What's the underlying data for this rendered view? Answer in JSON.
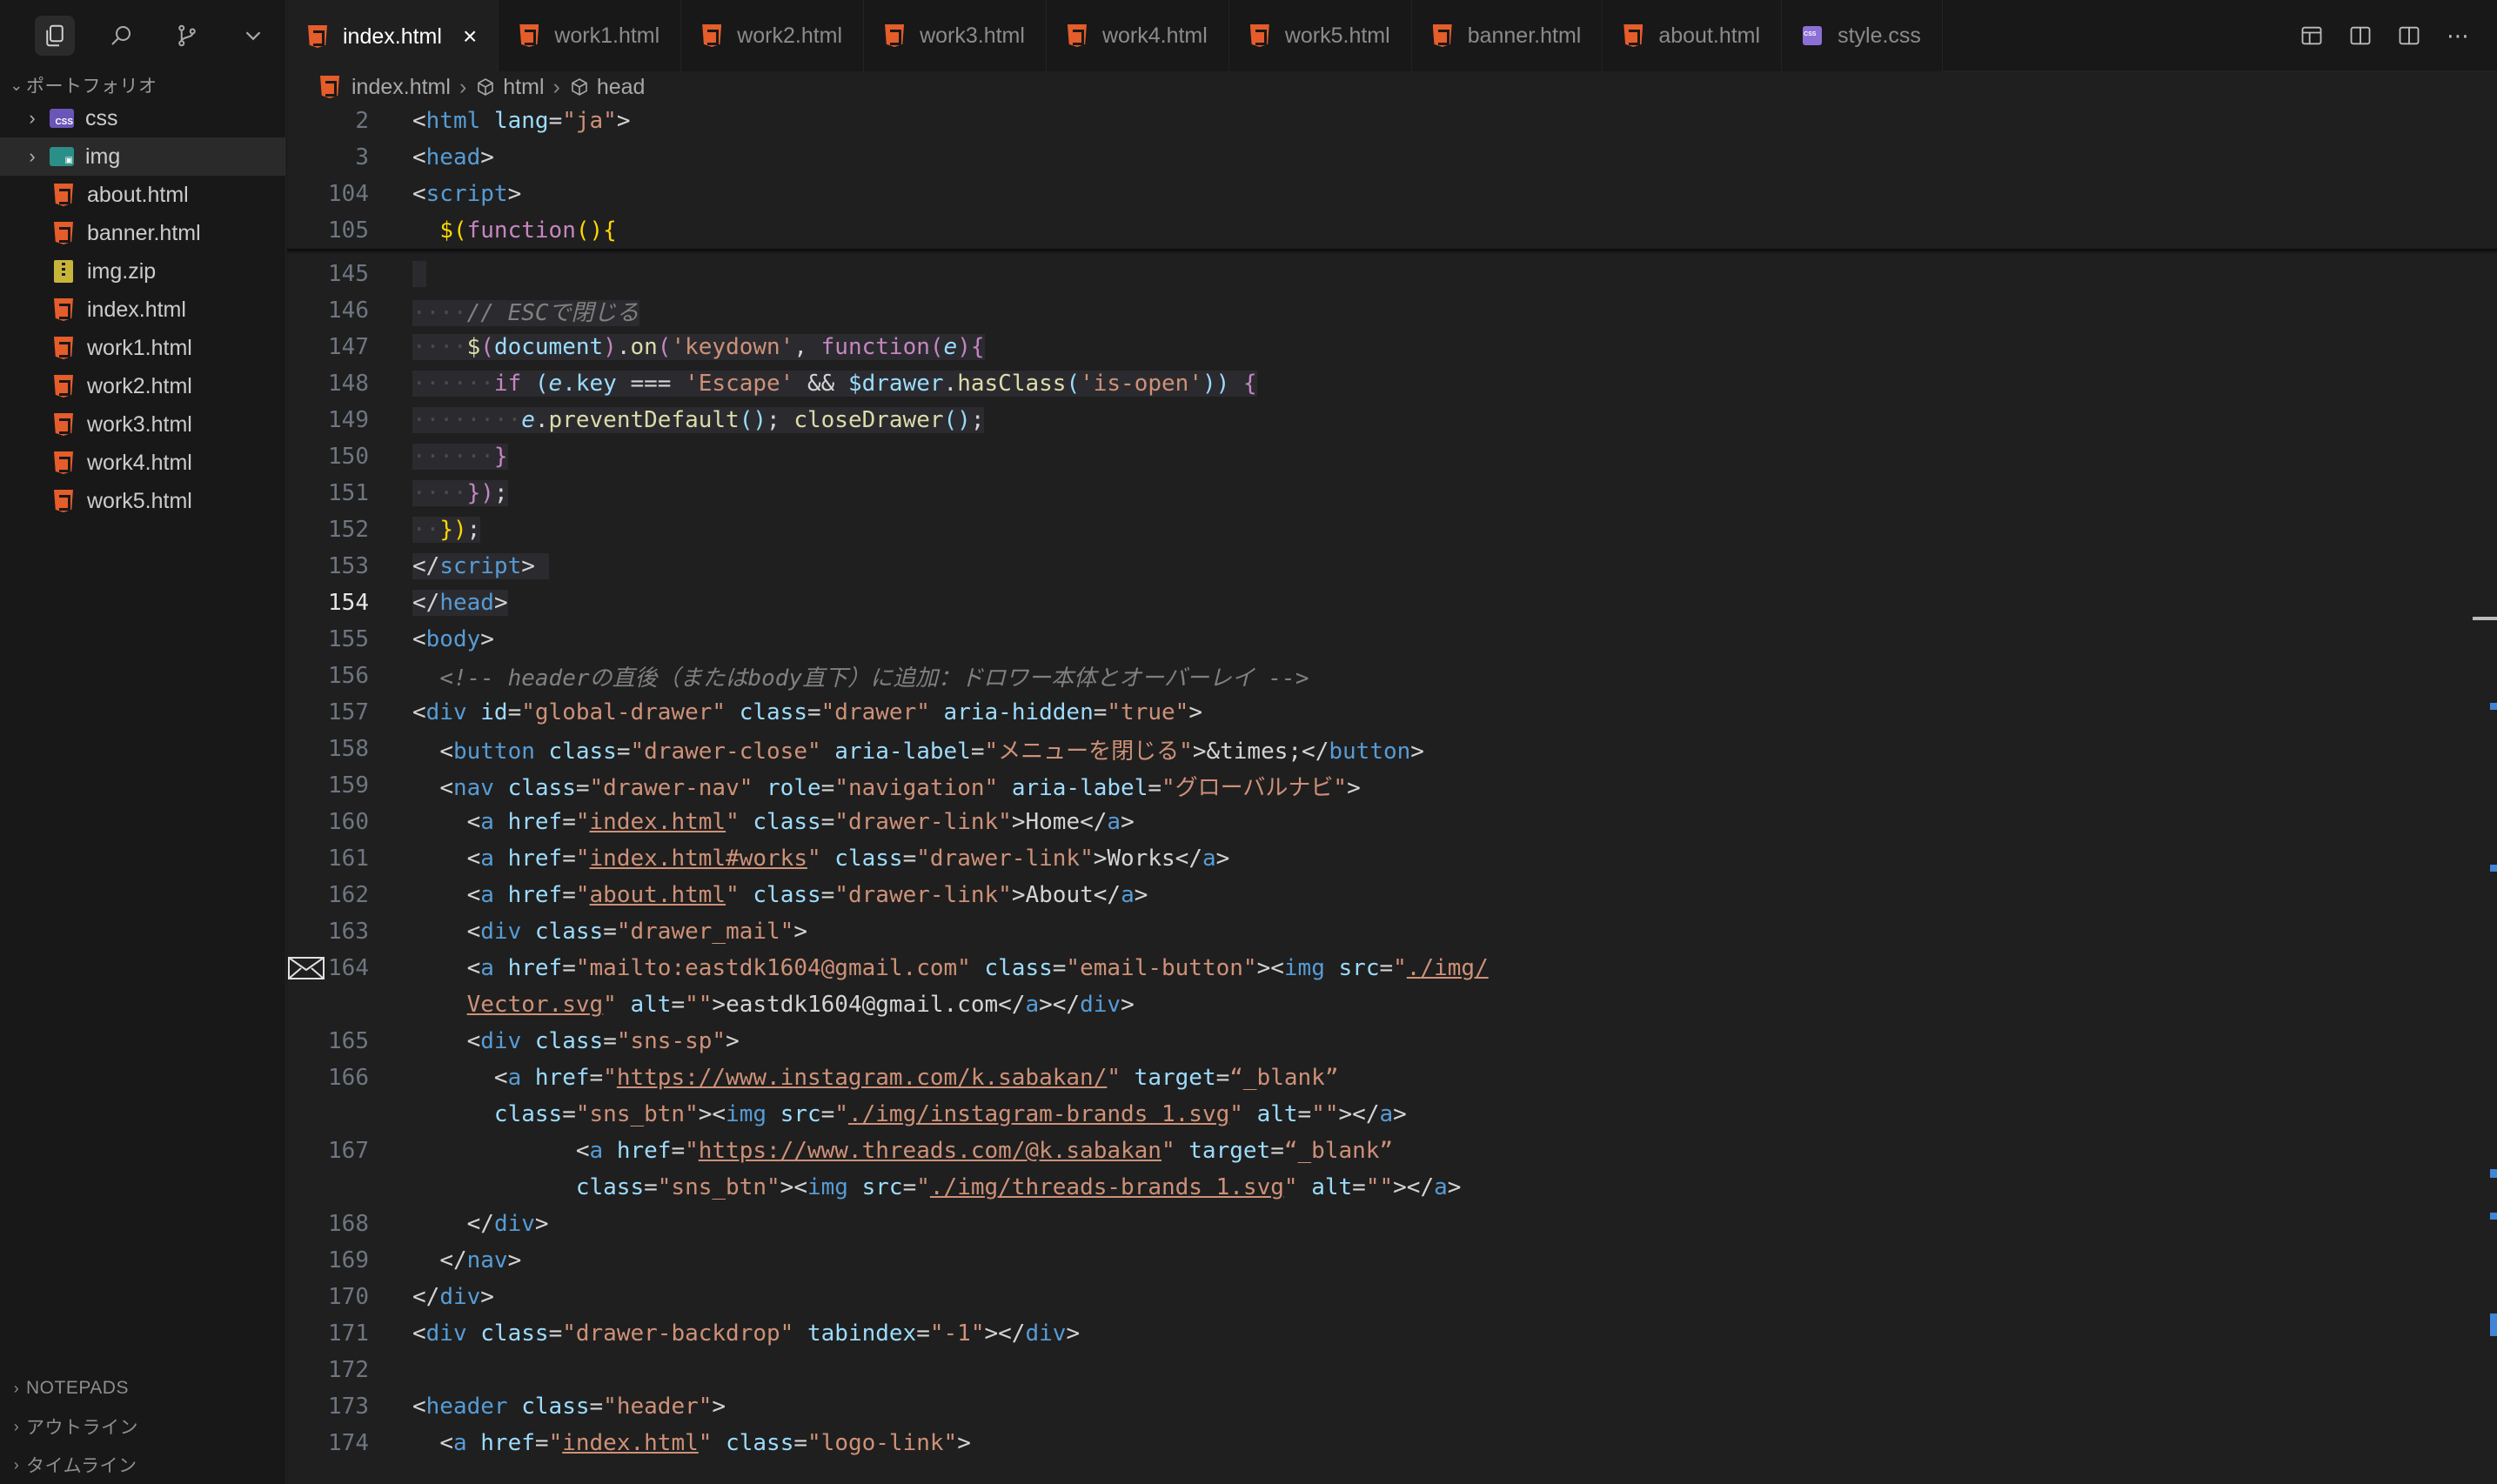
{
  "sidebar": {
    "activity": [
      "explorer-icon",
      "search-icon",
      "source-control-icon",
      "chevron-down-icon"
    ],
    "project_title": "ポートフォリオ",
    "items": [
      {
        "label": "css",
        "type": "folder",
        "icon": "css"
      },
      {
        "label": "img",
        "type": "folder",
        "icon": "img",
        "selected": true
      },
      {
        "label": "about.html",
        "type": "file"
      },
      {
        "label": "banner.html",
        "type": "file"
      },
      {
        "label": "img.zip",
        "type": "zip"
      },
      {
        "label": "index.html",
        "type": "file"
      },
      {
        "label": "work1.html",
        "type": "file"
      },
      {
        "label": "work2.html",
        "type": "file"
      },
      {
        "label": "work3.html",
        "type": "file"
      },
      {
        "label": "work4.html",
        "type": "file"
      },
      {
        "label": "work5.html",
        "type": "file"
      }
    ],
    "panels": [
      "NOTEPADS",
      "アウトライン",
      "タイムライン"
    ]
  },
  "tabs": [
    {
      "label": "index.html",
      "active": true
    },
    {
      "label": "work1.html"
    },
    {
      "label": "work2.html"
    },
    {
      "label": "work3.html"
    },
    {
      "label": "work4.html"
    },
    {
      "label": "work5.html"
    },
    {
      "label": "banner.html"
    },
    {
      "label": "about.html"
    },
    {
      "label": "style.css",
      "css": true
    }
  ],
  "breadcrumb": {
    "file": "index.html",
    "html": "html",
    "head": "head"
  },
  "editor": {
    "current_line": "154",
    "lines": [
      {
        "n": "2",
        "html": "<span class='pun'>&lt;</span><span class='t'>html</span> <span class='a'>lang</span><span class='pun'>=</span><span class='s'>\"ja\"</span><span class='pun'>&gt;</span>"
      },
      {
        "n": "3",
        "html": "<span class='pun'>&lt;</span><span class='t'>head</span><span class='pun'>&gt;</span>"
      },
      {
        "n": "104",
        "html": "<span class='pun'>&lt;</span><span class='t'>script</span><span class='pun'>&gt;</span>"
      },
      {
        "n": "105",
        "html": "  <span class='y'>$(</span><span class='k'>function</span><span class='y'>(){</span>"
      },
      {
        "n": "145",
        "html": "<span class='sel'> </span>"
      },
      {
        "n": "146",
        "html": "<span class='sel'><span class='ws'>····</span><span class='cmt'>// ESCで閉じる</span></span>"
      },
      {
        "n": "147",
        "html": "<span class='sel'><span class='ws'>····</span><span class='f'>$</span><span class='k'>(</span><span class='a'>document</span><span class='k'>)</span>.<span class='f'>on</span><span class='k'>(</span><span class='s'>'keydown'</span>, <span class='k'>function</span><span class='k'>(</span><span class='a'><i>e</i></span><span class='k'>){</span></span>"
      },
      {
        "n": "148",
        "html": "<span class='sel'><span class='ws'>······</span><span class='k'>if</span> <span class='a'>(</span><span class='a'><i>e</i>.key</span> === <span class='s'>'Escape'</span> &amp;&amp; <span class='a'>$drawer</span>.<span class='f'>hasClass</span><span class='a'>(</span><span class='s'>'is-open'</span><span class='a'>)</span><span class='a'>)</span> <span class='k'>{</span></span>"
      },
      {
        "n": "149",
        "html": "<span class='sel'><span class='ws'>········</span><span class='a'><i>e</i></span>.<span class='f'>preventDefault</span><span class='a'>()</span>; <span class='f'>closeDrawer</span><span class='a'>()</span>;</span>"
      },
      {
        "n": "150",
        "html": "<span class='sel'><span class='ws'>······</span><span class='k'>}</span></span>"
      },
      {
        "n": "151",
        "html": "<span class='sel'><span class='ws'>····</span><span class='k'>})</span>;</span>"
      },
      {
        "n": "152",
        "html": "<span class='sel'><span class='ws'>··</span><span class='y'>})</span>;</span>"
      },
      {
        "n": "153",
        "html": "<span class='sel'><span class='pun'>&lt;/</span><span class='t'>script</span><span class='pun'>&gt;</span> </span>"
      },
      {
        "n": "154",
        "html": "<span class='sel'><span class='pun'>&lt;/</span><span class='t'>head</span><span class='pun'>&gt;</span></span>"
      },
      {
        "n": "155",
        "html": "<span class='pun'>&lt;</span><span class='t'>body</span><span class='pun'>&gt;</span>"
      },
      {
        "n": "156",
        "html": "  <span class='cmt'>&lt;!-- headerの直後（またはbody直下）に追加：ドロワー本体とオーバーレイ --&gt;</span>"
      },
      {
        "n": "157",
        "html": "<span class='pun'>&lt;</span><span class='t'>div</span> <span class='a'>id</span><span class='pun'>=</span><span class='s'>\"global-drawer\"</span> <span class='a'>class</span><span class='pun'>=</span><span class='s'>\"drawer\"</span> <span class='a'>aria-hidden</span><span class='pun'>=</span><span class='s'>\"true\"</span><span class='pun'>&gt;</span>"
      },
      {
        "n": "158",
        "html": "  <span class='pun'>&lt;</span><span class='t'>button</span> <span class='a'>class</span><span class='pun'>=</span><span class='s'>\"drawer-close\"</span> <span class='a'>aria-label</span><span class='pun'>=</span><span class='s'>\"メニューを閉じる\"</span><span class='pun'>&gt;</span>&amp;times;<span class='pun'>&lt;/</span><span class='t'>button</span><span class='pun'>&gt;</span>"
      },
      {
        "n": "159",
        "html": "  <span class='pun'>&lt;</span><span class='t'>nav</span> <span class='a'>class</span><span class='pun'>=</span><span class='s'>\"drawer-nav\"</span> <span class='a'>role</span><span class='pun'>=</span><span class='s'>\"navigation\"</span> <span class='a'>aria-label</span><span class='pun'>=</span><span class='s'>\"グローバルナビ\"</span><span class='pun'>&gt;</span>"
      },
      {
        "n": "160",
        "html": "    <span class='pun'>&lt;</span><span class='t'>a</span> <span class='a'>href</span><span class='pun'>=</span><span class='s'>\"<span class='u'>index.html</span>\"</span> <span class='a'>class</span><span class='pun'>=</span><span class='s'>\"drawer-link\"</span><span class='pun'>&gt;</span>Home<span class='pun'>&lt;/</span><span class='t'>a</span><span class='pun'>&gt;</span>"
      },
      {
        "n": "161",
        "html": "    <span class='pun'>&lt;</span><span class='t'>a</span> <span class='a'>href</span><span class='pun'>=</span><span class='s'>\"<span class='u'>index.html#works</span>\"</span> <span class='a'>class</span><span class='pun'>=</span><span class='s'>\"drawer-link\"</span><span class='pun'>&gt;</span>Works<span class='pun'>&lt;/</span><span class='t'>a</span><span class='pun'>&gt;</span>"
      },
      {
        "n": "162",
        "html": "    <span class='pun'>&lt;</span><span class='t'>a</span> <span class='a'>href</span><span class='pun'>=</span><span class='s'>\"<span class='u'>about.html</span>\"</span> <span class='a'>class</span><span class='pun'>=</span><span class='s'>\"drawer-link\"</span><span class='pun'>&gt;</span>About<span class='pun'>&lt;/</span><span class='t'>a</span><span class='pun'>&gt;</span>"
      },
      {
        "n": "163",
        "html": "    <span class='pun'>&lt;</span><span class='t'>div</span> <span class='a'>class</span><span class='pun'>=</span><span class='s'>\"drawer_mail\"</span><span class='pun'>&gt;</span>"
      },
      {
        "n": "164",
        "mail": true,
        "html": "    <span class='pun'>&lt;</span><span class='t'>a</span> <span class='a'>href</span><span class='pun'>=</span><span class='s'>\"mailto:eastdk1604@gmail.com\"</span> <span class='a'>class</span><span class='pun'>=</span><span class='s'>\"email-button\"</span><span class='pun'>&gt;&lt;</span><span class='t'>img</span> <span class='a'>src</span><span class='pun'>=</span><span class='s'>\"<span class='u'>./img/</span></span>"
      },
      {
        "n": "",
        "html": "    <span class='s'><span class='u'>Vector.svg</span>\"</span> <span class='a'>alt</span><span class='pun'>=</span><span class='s'>\"\"</span><span class='pun'>&gt;</span>eastdk1604@gmail.com<span class='pun'>&lt;/</span><span class='t'>a</span><span class='pun'>&gt;&lt;/</span><span class='t'>div</span><span class='pun'>&gt;</span>"
      },
      {
        "n": "165",
        "html": "    <span class='pun'>&lt;</span><span class='t'>div</span> <span class='a'>class</span><span class='pun'>=</span><span class='s'>\"sns-sp\"</span><span class='pun'>&gt;</span>"
      },
      {
        "n": "166",
        "html": "      <span class='pun'>&lt;</span><span class='t'>a</span> <span class='a'>href</span><span class='pun'>=</span><span class='s'>\"<span class='u'>https://www.instagram.com/k.sabakan/</span>\"</span> <span class='a'>target</span><span class='pun'>=</span><span class='s'>“_blank”</span>"
      },
      {
        "n": "",
        "html": "      <span class='a'>class</span><span class='pun'>=</span><span class='s'>\"sns_btn\"</span><span class='pun'>&gt;&lt;</span><span class='t'>img</span> <span class='a'>src</span><span class='pun'>=</span><span class='s'>\"<span class='u'>./img/instagram-brands 1.svg</span>\"</span> <span class='a'>alt</span><span class='pun'>=</span><span class='s'>\"\"</span><span class='pun'>&gt;&lt;/</span><span class='t'>a</span><span class='pun'>&gt;</span>"
      },
      {
        "n": "167",
        "html": "            <span class='pun'>&lt;</span><span class='t'>a</span> <span class='a'>href</span><span class='pun'>=</span><span class='s'>\"<span class='u'>https://www.threads.com/@k.sabakan</span>\"</span> <span class='a'>target</span><span class='pun'>=</span><span class='s'>“_blank”</span>"
      },
      {
        "n": "",
        "html": "            <span class='a'>class</span><span class='pun'>=</span><span class='s'>\"sns_btn\"</span><span class='pun'>&gt;&lt;</span><span class='t'>img</span> <span class='a'>src</span><span class='pun'>=</span><span class='s'>\"<span class='u'>./img/threads-brands 1.svg</span>\"</span> <span class='a'>alt</span><span class='pun'>=</span><span class='s'>\"\"</span><span class='pun'>&gt;&lt;/</span><span class='t'>a</span><span class='pun'>&gt;</span>"
      },
      {
        "n": "168",
        "html": "    <span class='pun'>&lt;/</span><span class='t'>div</span><span class='pun'>&gt;</span>"
      },
      {
        "n": "169",
        "html": "  <span class='pun'>&lt;/</span><span class='t'>nav</span><span class='pun'>&gt;</span>"
      },
      {
        "n": "170",
        "html": "<span class='pun'>&lt;/</span><span class='t'>div</span><span class='pun'>&gt;</span>"
      },
      {
        "n": "171",
        "html": "<span class='pun'>&lt;</span><span class='t'>div</span> <span class='a'>class</span><span class='pun'>=</span><span class='s'>\"drawer-backdrop\"</span> <span class='a'>tabindex</span><span class='pun'>=</span><span class='s'>\"-1\"</span><span class='pun'>&gt;&lt;/</span><span class='t'>div</span><span class='pun'>&gt;</span>"
      },
      {
        "n": "172",
        "html": ""
      },
      {
        "n": "173",
        "html": "<span class='pun'>&lt;</span><span class='t'>header</span> <span class='a'>class</span><span class='pun'>=</span><span class='s'>\"header\"</span><span class='pun'>&gt;</span>"
      },
      {
        "n": "174",
        "html": "  <span class='pun'>&lt;</span><span class='t'>a</span> <span class='a'>href</span><span class='pun'>=</span><span class='s'>\"<span class='u'>index.html</span>\"</span> <span class='a'>class</span><span class='pun'>=</span><span class='s'>\"logo-link\"</span><span class='pun'>&gt;</span>"
      }
    ]
  }
}
